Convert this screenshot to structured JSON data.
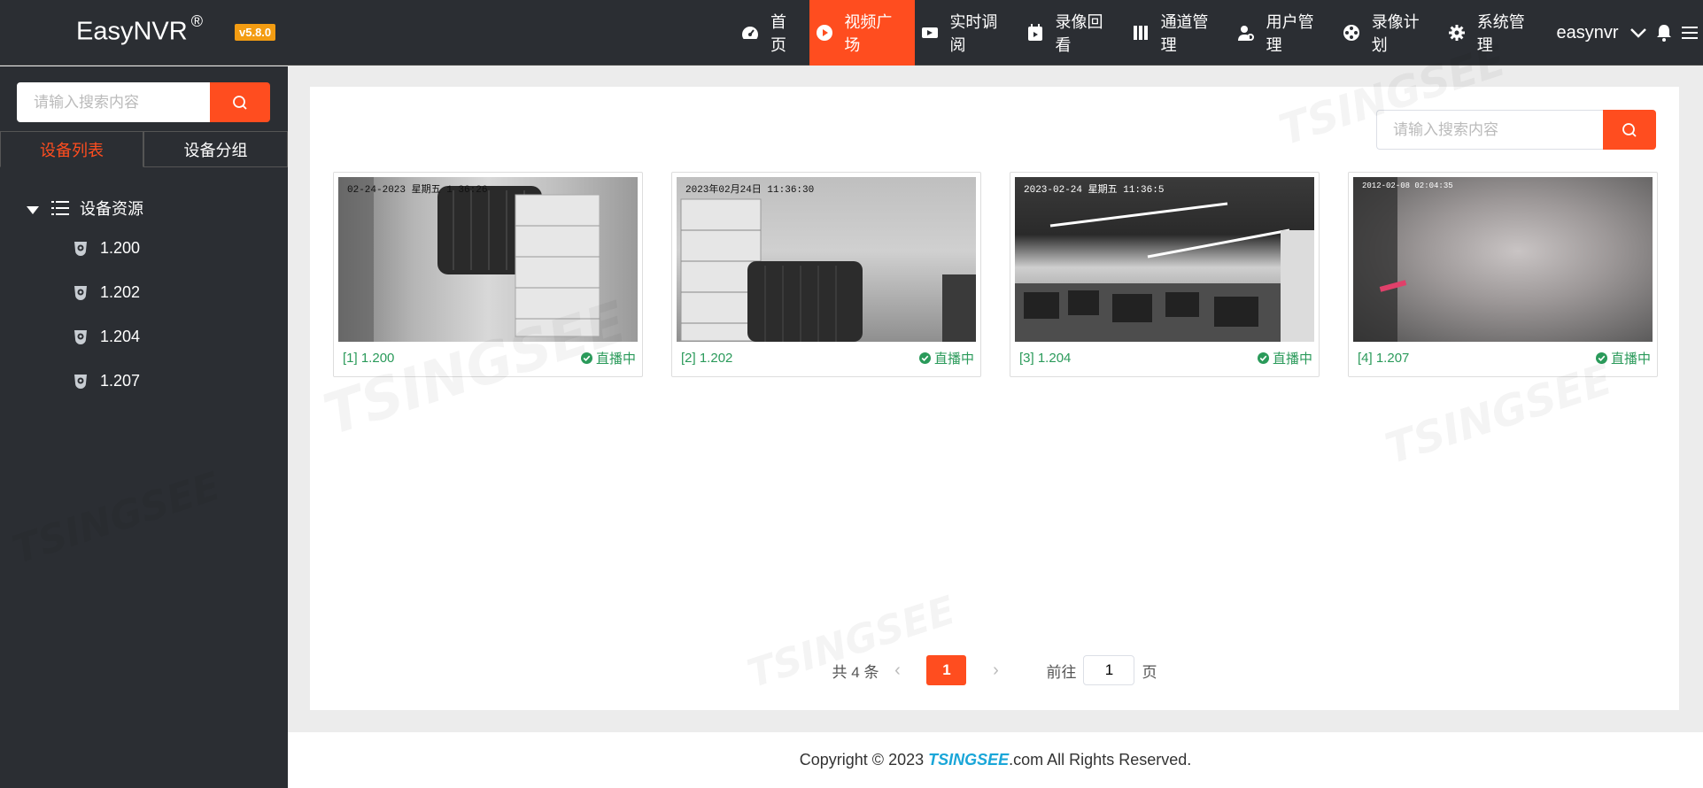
{
  "header": {
    "brand": "EasyNVR",
    "registered": "®",
    "version": "v5.8.0",
    "nav": [
      {
        "label": "首页",
        "icon": "dashboard-icon",
        "active": false
      },
      {
        "label": "视频广场",
        "icon": "play-circle-icon",
        "active": true
      },
      {
        "label": "实时调阅",
        "icon": "video-camera-icon",
        "active": false
      },
      {
        "label": "录像回看",
        "icon": "calendar-play-icon",
        "active": false
      },
      {
        "label": "通道管理",
        "icon": "columns-icon",
        "active": false
      },
      {
        "label": "用户管理",
        "icon": "user-gear-icon",
        "active": false
      },
      {
        "label": "录像计划",
        "icon": "film-reel-icon",
        "active": false
      },
      {
        "label": "系统管理",
        "icon": "gear-icon",
        "active": false
      }
    ],
    "user": "easynvr"
  },
  "sidebar": {
    "search_placeholder": "请输入搜索内容",
    "tabs": [
      {
        "label": "设备列表",
        "active": true
      },
      {
        "label": "设备分组",
        "active": false
      }
    ],
    "tree_root": "设备资源",
    "devices": [
      "1.200",
      "1.202",
      "1.204",
      "1.207"
    ]
  },
  "main": {
    "search_placeholder": "请输入搜索内容",
    "cards": [
      {
        "title": "[1] 1.200",
        "status": "直播中",
        "timestamp": "02-24-2023 星期五 1  36:26"
      },
      {
        "title": "[2] 1.202",
        "status": "直播中",
        "timestamp": "2023年02月24日 11:36:30"
      },
      {
        "title": "[3] 1.204",
        "status": "直播中",
        "timestamp": "2023-02-24 星期五 11:36:5"
      },
      {
        "title": "[4] 1.207",
        "status": "直播中",
        "timestamp": "2012-02-08 02:04:35"
      }
    ],
    "pagination": {
      "total": "共 4 条",
      "current": "1",
      "goto_prefix": "前往",
      "goto_value": "1",
      "goto_suffix": "页"
    }
  },
  "footer": {
    "copyright": "Copyright © 2023",
    "brand": "TSINGSEE",
    "suffix": ".com All Rights Reserved."
  },
  "colors": {
    "accent": "#ff4d1f",
    "header_bg": "#2b2e33",
    "version_badge": "#f39c12",
    "live_green": "#2a9a5a",
    "footer_brand": "#1aa6d8"
  }
}
